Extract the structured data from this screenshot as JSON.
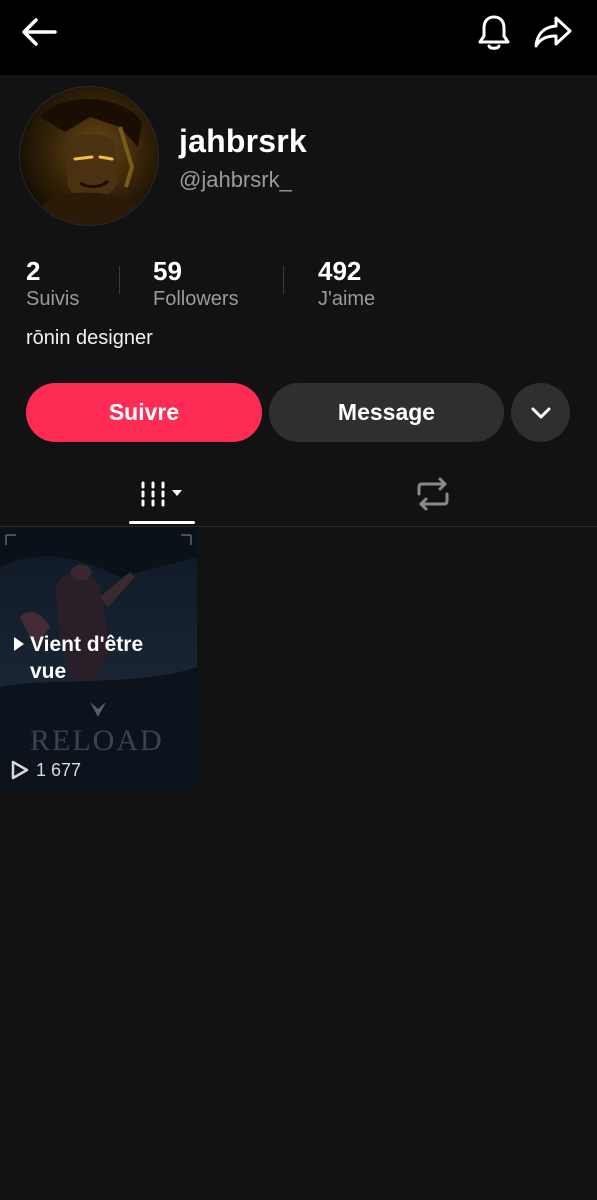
{
  "profile": {
    "display_name": "jahbrsrk",
    "handle": "@jahbrsrk_",
    "bio": "rōnin designer"
  },
  "stats": [
    {
      "value": "2",
      "label": "Suivis"
    },
    {
      "value": "59",
      "label": "Followers"
    },
    {
      "value": "492",
      "label": "J'aime"
    }
  ],
  "actions": {
    "follow_label": "Suivre",
    "message_label": "Message"
  },
  "videos": [
    {
      "badge": "Vient d'être vue",
      "views": "1 677",
      "watermark": "RELOAD"
    }
  ],
  "colors": {
    "accent": "#fe2c55",
    "background": "#121212",
    "topbar": "#000000",
    "secondary_button": "#2f2f2f",
    "muted_text": "#9a9a9a"
  },
  "icons": {
    "back": "back-arrow-icon",
    "notifications": "bell-icon",
    "share": "share-icon",
    "more": "chevron-down-icon",
    "videos_tab": "grid-icon",
    "reposts_tab": "repost-icon"
  }
}
